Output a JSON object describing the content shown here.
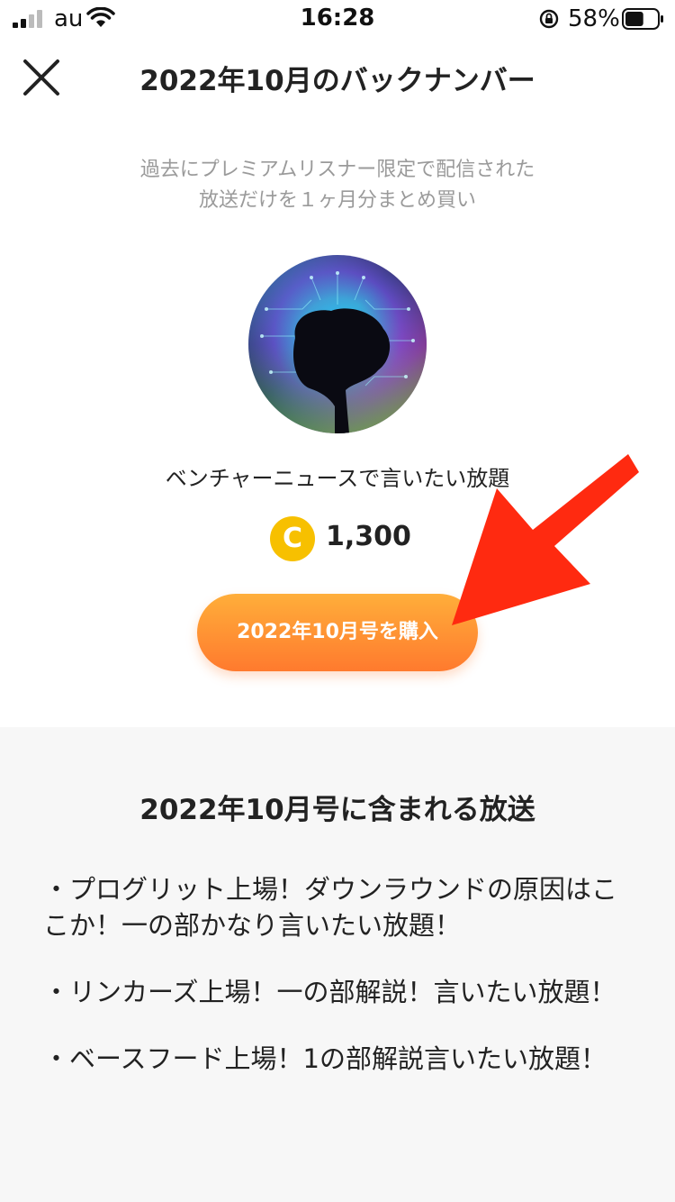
{
  "status_bar": {
    "carrier": "au",
    "time": "16:28",
    "battery_percent": "58%",
    "battery_level": 0.58
  },
  "header": {
    "title": "2022年10月のバックナンバー"
  },
  "description": {
    "line1": "過去にプレミアムリスナー限定で配信された",
    "line2": "放送だけを１ヶ月分まとめ買い"
  },
  "show": {
    "name": "ベンチャーニュースで言いたい放題"
  },
  "price": {
    "coin_symbol": "C",
    "amount": "1,300"
  },
  "buy_button": {
    "label": "2022年10月号を購入"
  },
  "episodes": {
    "title": "2022年10月号に含まれる放送",
    "items": [
      "・プログリット上場！ダウンラウンドの原因はここか！一の部かなり言いたい放題！",
      "・リンカーズ上場！一の部解説！言いたい放題！",
      "・ベースフード上場！1の部解説言いたい放題！"
    ]
  },
  "colors": {
    "accent_orange": "#ff8a30",
    "coin_yellow": "#f7c000",
    "annotation_arrow_red": "#ff2a10"
  }
}
